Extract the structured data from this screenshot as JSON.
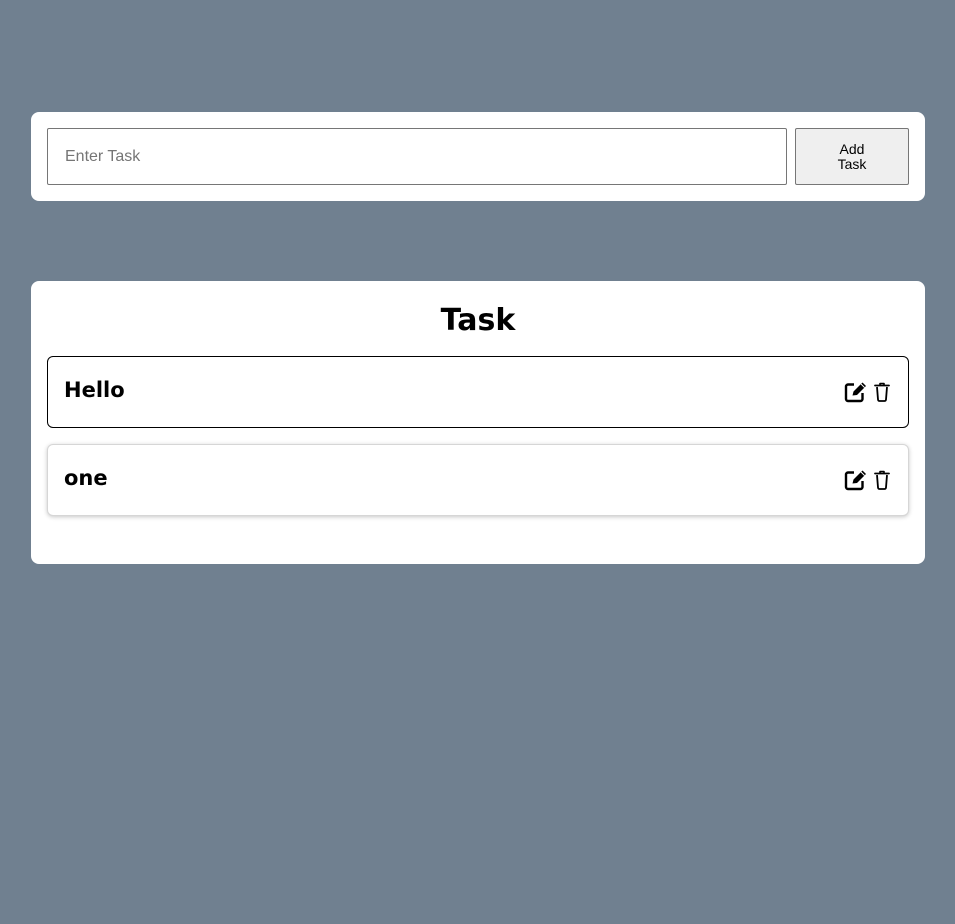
{
  "input_form": {
    "placeholder": "Enter Task",
    "value": "",
    "add_button_label": "Add Task"
  },
  "task_list": {
    "title": "Task",
    "items": [
      {
        "text": "Hello",
        "state": "focused",
        "icons": [
          "edit-icon",
          "trash-icon"
        ]
      },
      {
        "text": "one",
        "state": "normal",
        "icons": [
          "edit-icon",
          "trash-icon"
        ]
      }
    ]
  },
  "colors": {
    "background": "#708090",
    "card": "#ffffff",
    "button": "#efefef",
    "text": "#000000"
  }
}
